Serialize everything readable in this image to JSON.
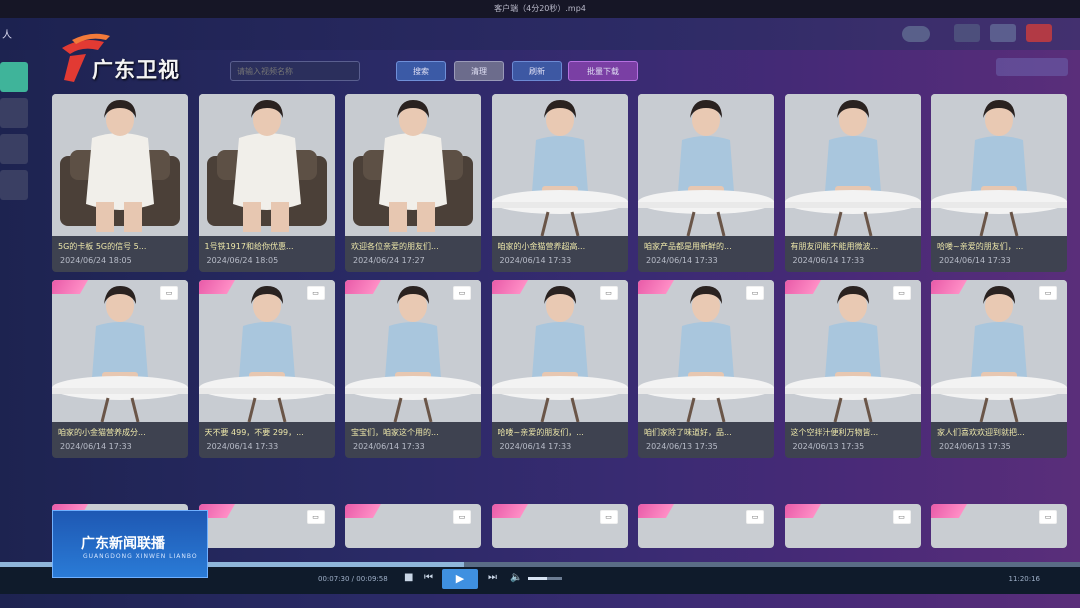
{
  "window": {
    "title": "客户端（4分20秒）.mp4",
    "app_name": "人"
  },
  "branding": {
    "channel_logo": "广东卫视",
    "news_logo": "广东新闻联播",
    "news_logo_en": "GUANGDONG XINWEN LIANBO"
  },
  "toolbar": {
    "search_placeholder": "请输入视频名称",
    "query_label": "搜索",
    "clear_label": "清理",
    "refresh_label": "刷新",
    "batch_download_label": "批量下载"
  },
  "grid": {
    "row1": [
      {
        "caption": "5G的卡板 5G的信号 5...",
        "date": "2024/06/24 18:05",
        "scene": "armchair"
      },
      {
        "caption": "1号铁1917和给你优惠...",
        "date": "2024/06/24 18:05",
        "scene": "armchair"
      },
      {
        "caption": "欢迎各位亲爱的朋友们...",
        "date": "2024/06/24 17:27",
        "scene": "armchair"
      },
      {
        "caption": "咱家的小金猫营养超高...",
        "date": "2024/06/14 17:33",
        "scene": "table"
      },
      {
        "caption": "咱家产品都是用新鲜的...",
        "date": "2024/06/14 17:33",
        "scene": "table"
      },
      {
        "caption": "有朋友问能不能用微波...",
        "date": "2024/06/14 17:33",
        "scene": "table"
      },
      {
        "caption": "哈喽~亲爱的朋友们，...",
        "date": "2024/06/14 17:33",
        "scene": "table"
      }
    ],
    "row2": [
      {
        "caption": "咱家的小金猫营养成分...",
        "date": "2024/06/14 17:33"
      },
      {
        "caption": "天不要 499，不要 299，...",
        "date": "2024/06/14 17:33"
      },
      {
        "caption": "宝宝们，咱家这个用的...",
        "date": "2024/06/14 17:33"
      },
      {
        "caption": "哈喽~亲爱的朋友们，...",
        "date": "2024/06/14 17:33"
      },
      {
        "caption": "咱们家除了味道好，品...",
        "date": "2024/06/13 17:35"
      },
      {
        "caption": "这个空拌汁便利万物皆...",
        "date": "2024/06/13 17:35"
      },
      {
        "caption": "家人们喜欢欢迎到就把...",
        "date": "2024/06/13 17:35"
      }
    ]
  },
  "player": {
    "time": "00:07:30 / 00:09:58",
    "clock": "11:20:16",
    "progress": 0.43,
    "volume": 0.55
  }
}
